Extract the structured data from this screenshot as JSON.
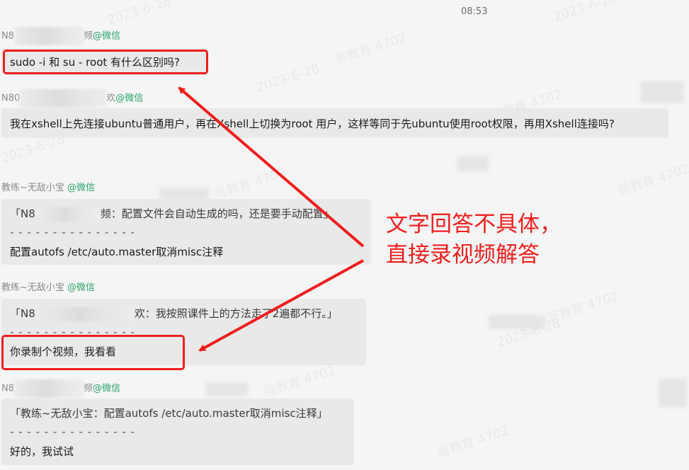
{
  "chat": {
    "timestamp": "08:53",
    "messages": [
      {
        "sender_prefix": "N8",
        "sender_suffix": "频",
        "sender_source": "@微信",
        "lines": [
          "sudo -i 和 su - root 有什么区别吗?"
        ]
      },
      {
        "sender_prefix": "N80",
        "sender_suffix": "欢",
        "sender_source": "@微信",
        "lines": [
          "我在xshell上先连接ubuntu普通用户，再在Xshell上切换为root 用户，这样等同于先ubuntu使用root权限，再用Xshell连接吗?"
        ]
      },
      {
        "sender_name": "教练~无敌小宝",
        "sender_source": "@微信",
        "quote_prefix": "「N8",
        "quote_suffix": "频：配置文件会自动生成的吗，还是要手动配置」",
        "divider": "- - - - - - - - - - - - - - -",
        "reply": "配置autofs /etc/auto.master取消misc注释"
      },
      {
        "sender_name": "教练~无敌小宝",
        "sender_source": "@微信",
        "quote_prefix": "「N8",
        "quote_suffix": "欢：我按照课件上的方法走了2遍都不行。」",
        "divider": "- - - - - - - - - - - - - - -",
        "reply": "你录制个视频，我看看"
      },
      {
        "sender_prefix": "N8",
        "sender_suffix": "频",
        "sender_source": "@微信",
        "quote": "「教练~无敌小宝：配置autofs /etc/auto.master取消misc注释」",
        "divider": "- - - - - - - - - - - - - - -",
        "reply": "好的，我试试"
      }
    ]
  },
  "annotation": {
    "text_line1": "文字回答不具体，",
    "text_line2": "直接录视频解答",
    "color": "#ef1d1d"
  },
  "watermarks": [
    "2023-6-28",
    "哥教育 4702"
  ]
}
